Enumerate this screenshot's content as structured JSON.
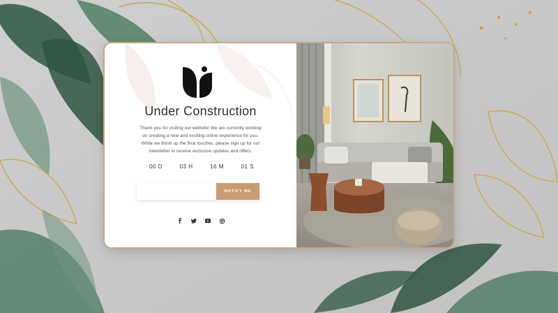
{
  "page": {
    "title": "Under Construction",
    "description": "Thank you for visiting our website! We are currently working on creating a new and exciting online experience for you. While we finish up the final touches, please sign up for our newsletter to receive exclusive updates and offers."
  },
  "countdown": {
    "days": "00 D",
    "hours": "03 H",
    "minutes": "16 M",
    "seconds": "01 S"
  },
  "newsletter": {
    "email_placeholder": "",
    "button_label": "NOTIFY ME"
  },
  "social": {
    "icons": [
      "facebook-icon",
      "twitter-icon",
      "youtube-icon",
      "instagram-icon"
    ]
  },
  "colors": {
    "accent": "#c99b73",
    "frame": "#c9a783",
    "background": "#c9c9c9",
    "leaf_dark": "#3f6b52",
    "gold": "#c9a640"
  }
}
